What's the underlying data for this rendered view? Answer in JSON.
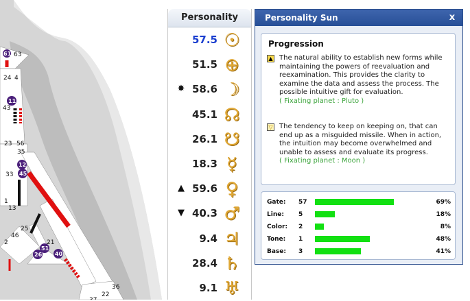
{
  "bodygraph": {
    "gate_numbers": [
      "61",
      "63",
      "24",
      "4",
      "11",
      "43",
      "23",
      "56",
      "35",
      "12",
      "45",
      "33",
      "1",
      "13",
      "25",
      "46",
      "2",
      "21",
      "51",
      "26",
      "40",
      "36",
      "22",
      "37"
    ]
  },
  "personality": {
    "header": "Personality",
    "rows": [
      {
        "mark": "",
        "value": "57.5",
        "planet_icon": "sun-icon",
        "glyph": "☉",
        "highlight": true
      },
      {
        "mark": "",
        "value": "51.5",
        "planet_icon": "earth-icon",
        "glyph": "⊕",
        "highlight": false
      },
      {
        "mark": "✸",
        "value": "58.6",
        "planet_icon": "moon-icon",
        "glyph": "☽",
        "highlight": false
      },
      {
        "mark": "",
        "value": "45.1",
        "planet_icon": "north-node-icon",
        "glyph": "☊",
        "highlight": false
      },
      {
        "mark": "",
        "value": "26.1",
        "planet_icon": "south-node-icon",
        "glyph": "☋",
        "highlight": false
      },
      {
        "mark": "",
        "value": "18.3",
        "planet_icon": "mercury-icon",
        "glyph": "☿",
        "highlight": false
      },
      {
        "mark": "▲",
        "value": "59.6",
        "planet_icon": "venus-icon",
        "glyph": "♀",
        "highlight": false
      },
      {
        "mark": "▼",
        "value": "40.3",
        "planet_icon": "mars-icon",
        "glyph": "♂",
        "highlight": false
      },
      {
        "mark": "",
        "value": "9.4",
        "planet_icon": "jupiter-icon",
        "glyph": "♃",
        "highlight": false
      },
      {
        "mark": "",
        "value": "28.4",
        "planet_icon": "saturn-icon",
        "glyph": "♄",
        "highlight": false
      },
      {
        "mark": "",
        "value": "9.1",
        "planet_icon": "uranus-icon",
        "glyph": "♅",
        "highlight": false
      }
    ]
  },
  "panel": {
    "title": "Personality Sun",
    "close_label": "x",
    "progression": {
      "title": "Progression",
      "exalted": {
        "icon": "▲",
        "text": "The natural ability to establish new forms while maintaining the powers of reevaluation and reexamination. This provides the clarity to examine the data and assess the process. The possible intuitive gift for evaluation.",
        "planet": "( Fixating planet : Pluto )"
      },
      "detriment": {
        "icon": "▽",
        "text": "The tendency to keep on keeping on, that can end up as a misguided missile. When in action, the intuition may become overwhelmed and unable to assess and evaluate its progress.",
        "planet": "( Fixating planet : Moon )"
      }
    },
    "stats": [
      {
        "label": "Gate:",
        "value": "57",
        "percent": "69%",
        "fill": 0.72
      },
      {
        "label": "Line:",
        "value": "5",
        "percent": "18%",
        "fill": 0.18
      },
      {
        "label": "Color:",
        "value": "2",
        "percent": "8%",
        "fill": 0.08
      },
      {
        "label": "Tone:",
        "value": "1",
        "percent": "48%",
        "fill": 0.5
      },
      {
        "label": "Base:",
        "value": "3",
        "percent": "41%",
        "fill": 0.42
      }
    ]
  },
  "colors": {
    "accent": "#274f97",
    "bar": "#12e012",
    "channel_red": "#e01010",
    "badge": "#4a1f7a"
  }
}
